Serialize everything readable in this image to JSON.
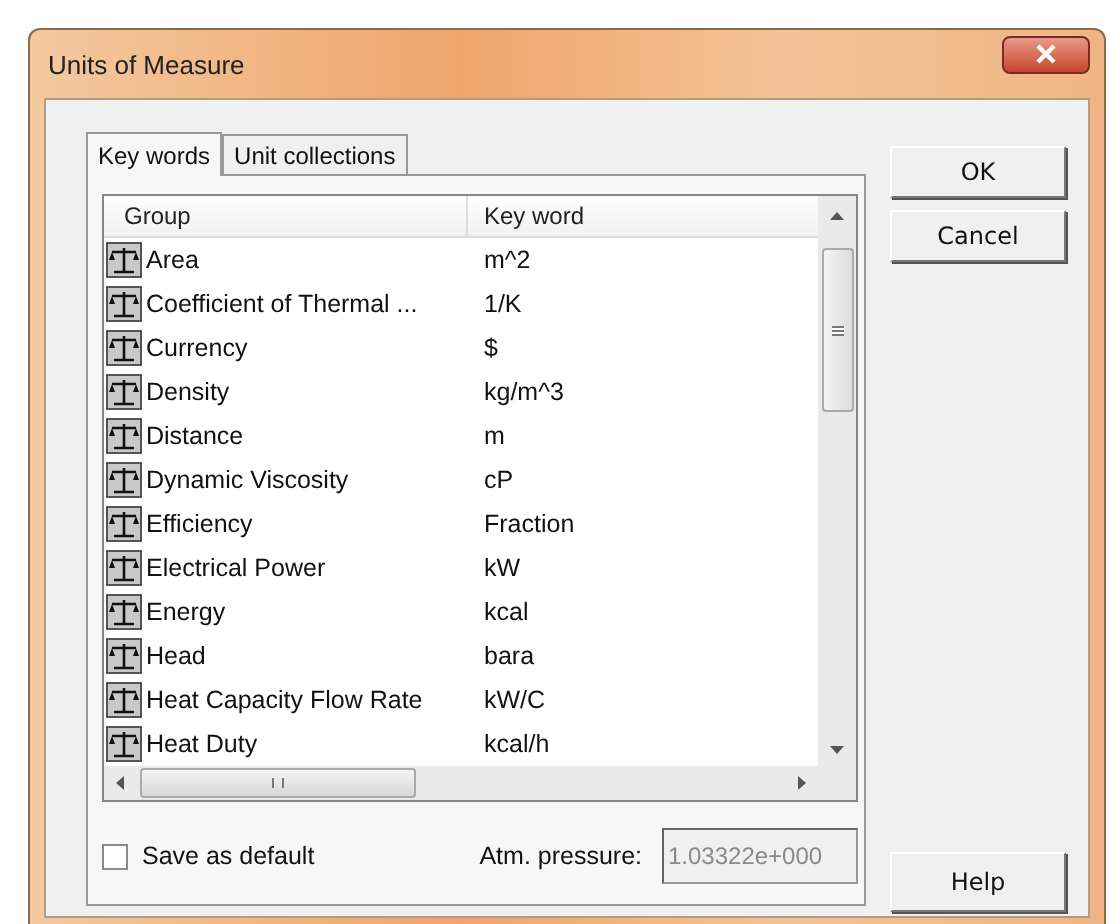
{
  "window": {
    "title": "Units of Measure"
  },
  "tabs": [
    {
      "label": "Key words",
      "selected": true
    },
    {
      "label": "Unit collections",
      "selected": false
    }
  ],
  "table": {
    "columns": [
      "Group",
      "Key word"
    ],
    "rows": [
      {
        "group": "Area",
        "key_word": "m^2"
      },
      {
        "group": "Coefficient of Thermal ...",
        "key_word": "1/K"
      },
      {
        "group": "Currency",
        "key_word": "$"
      },
      {
        "group": "Density",
        "key_word": "kg/m^3"
      },
      {
        "group": "Distance",
        "key_word": "m"
      },
      {
        "group": "Dynamic Viscosity",
        "key_word": "cP"
      },
      {
        "group": "Efficiency",
        "key_word": "Fraction"
      },
      {
        "group": "Electrical Power",
        "key_word": "kW"
      },
      {
        "group": "Energy",
        "key_word": "kcal"
      },
      {
        "group": "Head",
        "key_word": "bara"
      },
      {
        "group": "Heat Capacity Flow Rate",
        "key_word": "kW/C"
      },
      {
        "group": "Heat Duty",
        "key_word": "kcal/h"
      }
    ]
  },
  "save_default": {
    "label": "Save as default",
    "checked": false
  },
  "atm_pressure": {
    "label": "Atm. pressure:",
    "value": "1.03322e+000",
    "disabled": true
  },
  "buttons": [
    {
      "label": "OK"
    },
    {
      "label": "Cancel"
    }
  ],
  "help_button": {
    "label": "Help"
  }
}
